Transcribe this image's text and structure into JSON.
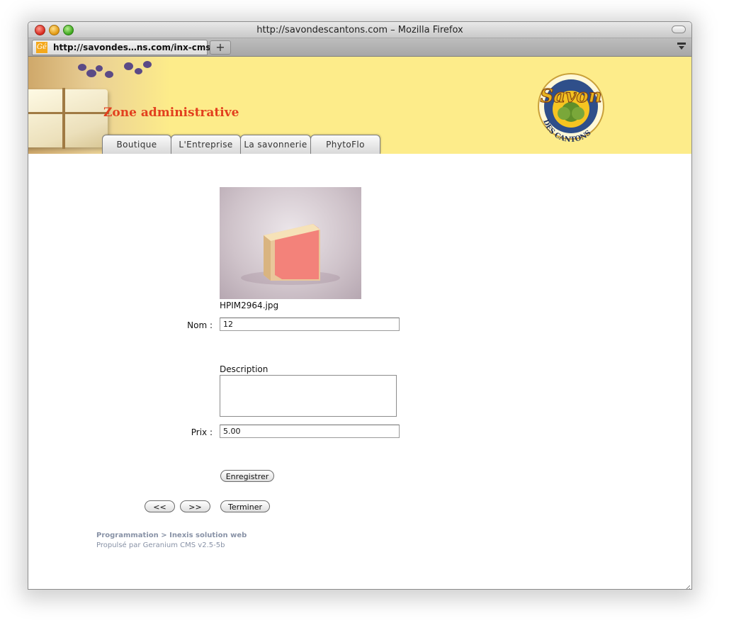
{
  "window": {
    "title": "http://savondescantons.com – Mozilla Firefox"
  },
  "browser": {
    "tab_label": "http://savondes…ns.com/inx-cms/",
    "favicon_text": "Gé",
    "new_tab_symbol": "+"
  },
  "header": {
    "admin_title": "Zone administrative",
    "logo_alt": "Savon des Cantons logo",
    "tabs": [
      {
        "label": "Boutique"
      },
      {
        "label": "L'Entreprise"
      },
      {
        "label": "La savonnerie"
      },
      {
        "label": "PhytoFlo"
      }
    ],
    "colors": {
      "banner": "#fdec8a",
      "title": "#e2401e"
    }
  },
  "form": {
    "image_filename": "HPIM2964.jpg",
    "nom_label": "Nom :",
    "nom_value": "12",
    "description_label": "Description",
    "description_value": "",
    "prix_label": "Prix :",
    "prix_value": "5.00",
    "save_button": "Enregistrer",
    "prev_button": "<<",
    "next_button": ">>",
    "finish_button": "Terminer"
  },
  "footer": {
    "line1": "Programmation > Inexis solution web",
    "line2": "Propulsé par Geranium CMS v2.5-5b"
  }
}
